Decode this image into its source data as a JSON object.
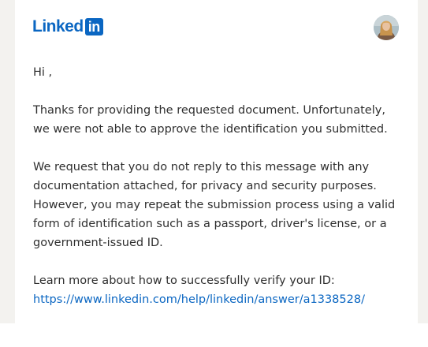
{
  "brand": {
    "logo_word": "Linked",
    "logo_box": "in",
    "color": "#0a66c2"
  },
  "header": {
    "avatar_icon": "user-avatar"
  },
  "email": {
    "greeting": "Hi ,",
    "paragraph_1": "Thanks for providing the requested document. Unfortunately, we were not able to approve the identification you submitted.",
    "paragraph_2": "We request that you do not reply to this message with any documentation attached, for privacy and security purposes. However, you may repeat the submission process using a valid form of identification such as a passport, driver's license, or a government-issued ID.",
    "learn_more": "Learn more about how to successfully verify your ID:",
    "help_link": "https://www.linkedin.com/help/linkedin/answer/a1338528/"
  }
}
